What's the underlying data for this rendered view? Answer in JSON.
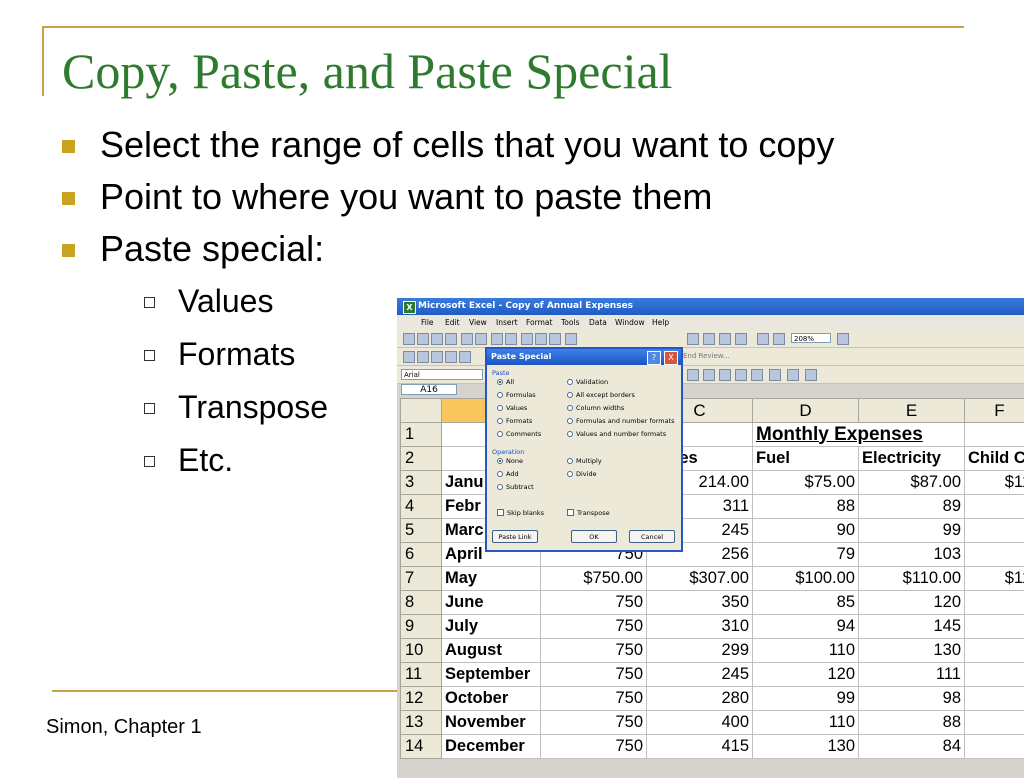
{
  "slide": {
    "title": "Copy, Paste, and Paste Special",
    "bullets": [
      "Select the range of cells that you want to copy",
      "Point to where you want to paste them",
      "Paste special:"
    ],
    "sub_bullets": [
      "Values",
      "Formats",
      "Transpose",
      "Etc."
    ],
    "footer": "Simon, Chapter 1",
    "accent_color": "#c9a31f",
    "title_color": "#2e7a2e"
  },
  "excel": {
    "window_title": "Microsoft Excel - Copy of Annual Expenses",
    "menu": [
      "File",
      "Edit",
      "View",
      "Insert",
      "Format",
      "Tools",
      "Data",
      "Window",
      "Help"
    ],
    "zoom": "208%",
    "font_name": "Arial",
    "reply_review": "End Review...",
    "name_box": "A16",
    "columns": [
      "A",
      "B",
      "C",
      "D",
      "E",
      "F"
    ],
    "rows": [
      {
        "n": "1",
        "a": "",
        "b": "",
        "c": "",
        "d": "Monthly Expenses",
        "e": "",
        "f": ""
      },
      {
        "n": "2",
        "a": "",
        "b": "",
        "c": "ceries",
        "d": "Fuel",
        "e": "Electricity",
        "f": "Child C"
      },
      {
        "n": "3",
        "a": "Janu",
        "b": "",
        "c": "214.00",
        "d": "$75.00",
        "e": "$87.00",
        "f": "$11"
      },
      {
        "n": "4",
        "a": "Febr",
        "b": "",
        "c": "311",
        "d": "88",
        "e": "89",
        "f": ""
      },
      {
        "n": "5",
        "a": "Marc",
        "b": "",
        "c": "245",
        "d": "90",
        "e": "99",
        "f": ""
      },
      {
        "n": "6",
        "a": "April",
        "b": "750",
        "c": "256",
        "d": "79",
        "e": "103",
        "f": ""
      },
      {
        "n": "7",
        "a": "May",
        "b": "$750.00",
        "c": "$307.00",
        "d": "$100.00",
        "e": "$110.00",
        "f": "$11"
      },
      {
        "n": "8",
        "a": "June",
        "b": "750",
        "c": "350",
        "d": "85",
        "e": "120",
        "f": ""
      },
      {
        "n": "9",
        "a": "July",
        "b": "750",
        "c": "310",
        "d": "94",
        "e": "145",
        "f": ""
      },
      {
        "n": "10",
        "a": "August",
        "b": "750",
        "c": "299",
        "d": "110",
        "e": "130",
        "f": ""
      },
      {
        "n": "11",
        "a": "September",
        "b": "750",
        "c": "245",
        "d": "120",
        "e": "111",
        "f": ""
      },
      {
        "n": "12",
        "a": "October",
        "b": "750",
        "c": "280",
        "d": "99",
        "e": "98",
        "f": ""
      },
      {
        "n": "13",
        "a": "November",
        "b": "750",
        "c": "400",
        "d": "110",
        "e": "88",
        "f": ""
      },
      {
        "n": "14",
        "a": "December",
        "b": "750",
        "c": "415",
        "d": "130",
        "e": "84",
        "f": ""
      }
    ]
  },
  "paste_special": {
    "title": "Paste Special",
    "help": "?",
    "close": "X",
    "paste_group": "Paste",
    "paste_left": [
      "All",
      "Formulas",
      "Values",
      "Formats",
      "Comments"
    ],
    "paste_right": [
      "Validation",
      "All except borders",
      "Column widths",
      "Formulas and number formats",
      "Values and number formats"
    ],
    "operation_group": "Operation",
    "op_left": [
      "None",
      "Add",
      "Subtract"
    ],
    "op_right": [
      "Multiply",
      "Divide"
    ],
    "skip_blanks": "Skip blanks",
    "transpose": "Transpose",
    "paste_link": "Paste Link",
    "ok": "OK",
    "cancel": "Cancel"
  }
}
